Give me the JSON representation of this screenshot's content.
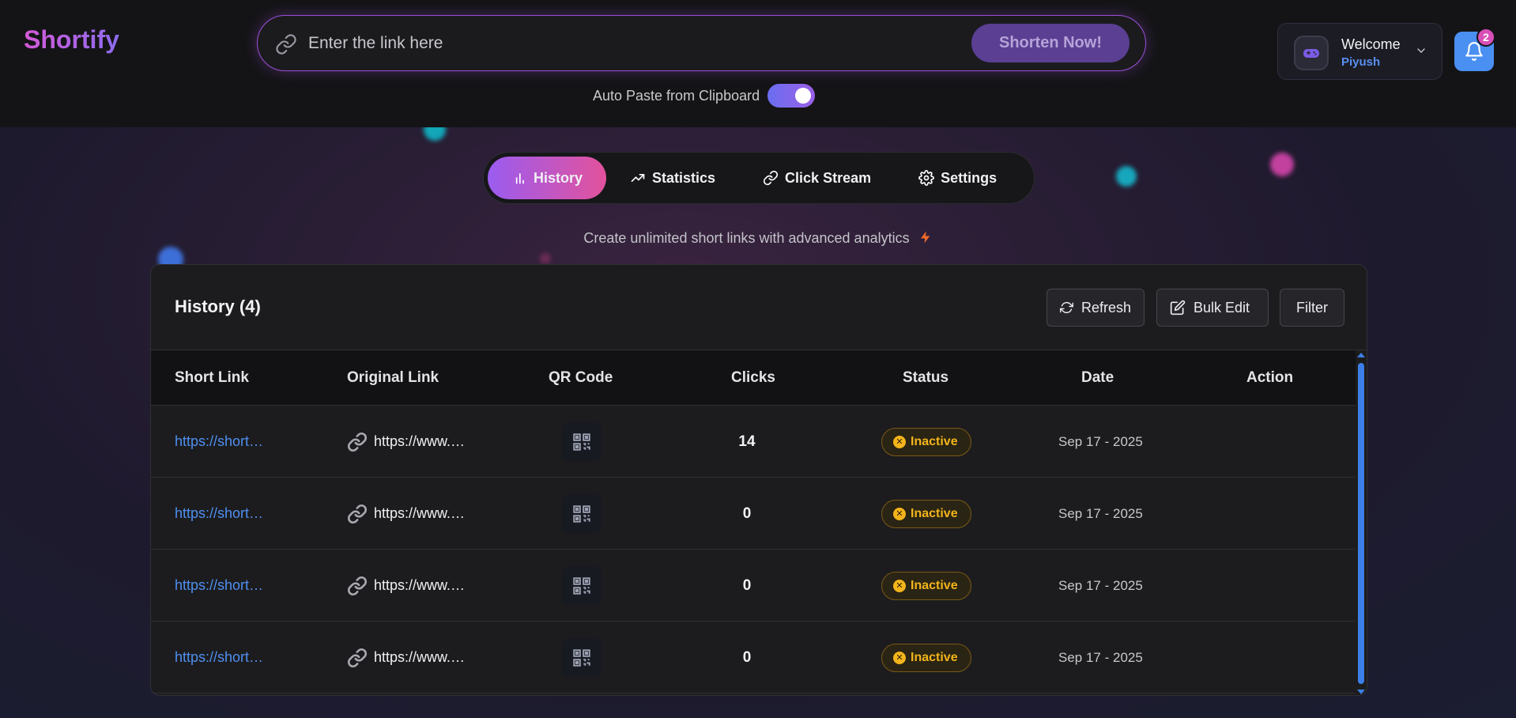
{
  "app": {
    "logo": "Shortify"
  },
  "search": {
    "placeholder": "Enter the link here",
    "value": "",
    "submit_label": "Shorten Now!"
  },
  "auto_paste": {
    "label": "Auto Paste from Clipboard",
    "enabled": true
  },
  "user": {
    "greeting": "Welcome",
    "name": "Piyush",
    "avatar_icon": "gamepad-icon"
  },
  "notifications": {
    "count": "2"
  },
  "tabs": [
    {
      "label": "History",
      "icon": "bar-chart-icon",
      "active": true
    },
    {
      "label": "Statistics",
      "icon": "trending-up-icon",
      "active": false
    },
    {
      "label": "Click Stream",
      "icon": "link-icon",
      "active": false
    },
    {
      "label": "Settings",
      "icon": "gear-icon",
      "active": false
    }
  ],
  "tagline": "Create unlimited short links with advanced analytics",
  "history": {
    "title": "History (4)",
    "buttons": {
      "refresh": "Refresh",
      "bulk_edit": "Bulk Edit",
      "filter": "Filter"
    },
    "columns": [
      "Short Link",
      "Original Link",
      "QR Code",
      "Clicks",
      "Status",
      "Date",
      "Action"
    ],
    "rows": [
      {
        "short": "https://short…",
        "original": "https://www.…",
        "clicks": "14",
        "status": "Inactive",
        "date": "Sep 17 - 2025"
      },
      {
        "short": "https://short…",
        "original": "https://www.…",
        "clicks": "0",
        "status": "Inactive",
        "date": "Sep 17 - 2025"
      },
      {
        "short": "https://short…",
        "original": "https://www.…",
        "clicks": "0",
        "status": "Inactive",
        "date": "Sep 17 - 2025"
      },
      {
        "short": "https://short…",
        "original": "https://www.…",
        "clicks": "0",
        "status": "Inactive",
        "date": "Sep 17 - 2025"
      }
    ]
  },
  "colors": {
    "accent_purple": "#9b4fd6",
    "accent_pink": "#e3529c",
    "link_blue": "#4f8ff0",
    "status_inactive": "#f2b41a"
  }
}
